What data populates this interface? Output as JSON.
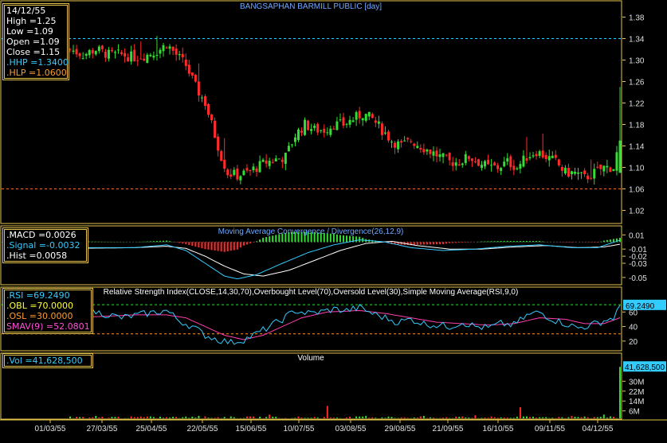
{
  "chart_data": {
    "type": "candlestick",
    "title": "BANGSAPHAN BARMILL PUBLIC [day]",
    "colors": {
      "background": "#000000",
      "frame": "#e6c34a",
      "up": "#33dd33",
      "down": "#ff2a2a",
      "text": "#e0e0e0",
      "title": "#6fa8ff",
      "hhp_line": "#33ccff",
      "hlp_line": "#ff6a2a"
    },
    "x_tick_labels": [
      "01/03/55",
      "27/03/55",
      "25/04/55",
      "22/05/55",
      "15/06/55",
      "10/07/55",
      "03/08/55",
      "29/08/55",
      "21/09/55",
      "16/10/55",
      "09/11/55",
      "04/12/55"
    ],
    "price_panel": {
      "ylim": [
        1.0,
        1.4
      ],
      "y_ticks": [
        "1.02",
        "1.06",
        "1.10",
        "1.14",
        "1.18",
        "1.22",
        "1.26",
        "1.30",
        "1.34",
        "1.38"
      ],
      "hhp": 1.34,
      "hlp": 1.06,
      "close_path": [
        [
          0,
          1.32
        ],
        [
          4,
          1.31
        ],
        [
          8,
          1.32
        ],
        [
          12,
          1.31
        ],
        [
          16,
          1.31
        ],
        [
          20,
          1.305
        ],
        [
          24,
          1.31
        ],
        [
          28,
          1.32
        ],
        [
          30,
          1.33
        ],
        [
          33,
          1.31
        ],
        [
          36,
          1.29
        ],
        [
          39,
          1.25
        ],
        [
          42,
          1.22
        ],
        [
          45,
          1.16
        ],
        [
          47,
          1.12
        ],
        [
          49,
          1.09
        ],
        [
          52,
          1.085
        ],
        [
          55,
          1.09
        ],
        [
          58,
          1.1
        ],
        [
          61,
          1.11
        ],
        [
          64,
          1.115
        ],
        [
          67,
          1.12
        ],
        [
          70,
          1.16
        ],
        [
          73,
          1.18
        ],
        [
          76,
          1.17
        ],
        [
          79,
          1.17
        ],
        [
          82,
          1.18
        ],
        [
          85,
          1.18
        ],
        [
          88,
          1.19
        ],
        [
          91,
          1.2
        ],
        [
          94,
          1.19
        ],
        [
          97,
          1.17
        ],
        [
          100,
          1.15
        ],
        [
          103,
          1.14
        ],
        [
          106,
          1.15
        ],
        [
          109,
          1.14
        ],
        [
          112,
          1.13
        ],
        [
          115,
          1.12
        ],
        [
          118,
          1.11
        ],
        [
          121,
          1.11
        ],
        [
          124,
          1.12
        ],
        [
          127,
          1.11
        ],
        [
          130,
          1.1
        ],
        [
          133,
          1.1
        ],
        [
          136,
          1.11
        ],
        [
          139,
          1.1
        ],
        [
          142,
          1.12
        ],
        [
          145,
          1.13
        ],
        [
          148,
          1.12
        ],
        [
          151,
          1.11
        ],
        [
          154,
          1.09
        ],
        [
          157,
          1.09
        ],
        [
          160,
          1.08
        ],
        [
          163,
          1.09
        ],
        [
          166,
          1.1
        ],
        [
          169,
          1.1
        ],
        [
          171,
          1.15
        ]
      ],
      "last": {
        "date": "14/12/55",
        "high": 1.25,
        "low": 1.09,
        "open": 1.09,
        "close": 1.15
      }
    },
    "macd_panel": {
      "title": "Moving Average Convergence / Divergence(26,12,9)",
      "ylim": [
        -0.058,
        0.016
      ],
      "y_ticks": [
        "0.01",
        "-0.01",
        "-0.02",
        "-0.03",
        "-0.05"
      ],
      "macd_path": [
        [
          0,
          -0.008
        ],
        [
          20,
          -0.008
        ],
        [
          30,
          -0.004
        ],
        [
          36,
          -0.012
        ],
        [
          42,
          -0.03
        ],
        [
          48,
          -0.048
        ],
        [
          52,
          -0.052
        ],
        [
          58,
          -0.046
        ],
        [
          66,
          -0.03
        ],
        [
          74,
          -0.015
        ],
        [
          82,
          -0.004
        ],
        [
          90,
          0.003
        ],
        [
          98,
          0.0
        ],
        [
          106,
          -0.008
        ],
        [
          116,
          -0.012
        ],
        [
          126,
          -0.01
        ],
        [
          136,
          -0.006
        ],
        [
          146,
          -0.004
        ],
        [
          156,
          -0.008
        ],
        [
          164,
          -0.008
        ],
        [
          171,
          0.0026
        ]
      ],
      "signal_path": [
        [
          0,
          -0.009
        ],
        [
          20,
          -0.008
        ],
        [
          30,
          -0.006
        ],
        [
          36,
          -0.009
        ],
        [
          42,
          -0.02
        ],
        [
          48,
          -0.034
        ],
        [
          54,
          -0.045
        ],
        [
          60,
          -0.048
        ],
        [
          68,
          -0.04
        ],
        [
          76,
          -0.026
        ],
        [
          84,
          -0.012
        ],
        [
          92,
          -0.002
        ],
        [
          100,
          0.001
        ],
        [
          108,
          -0.005
        ],
        [
          118,
          -0.01
        ],
        [
          128,
          -0.01
        ],
        [
          138,
          -0.007
        ],
        [
          148,
          -0.005
        ],
        [
          158,
          -0.008
        ],
        [
          166,
          -0.007
        ],
        [
          171,
          -0.0032
        ]
      ],
      "macd": 0.0026,
      "signal": -0.0032,
      "hist": 0.0058
    },
    "rsi_panel": {
      "title": "Relative Strength Index(CLOSE,14,30,70),Overbought Level(70),Oversold Level(30),Simple Moving Average(RSI,9,0)",
      "ylim": [
        10,
        80
      ],
      "y_ticks": [
        "20",
        "40",
        "60"
      ],
      "rsi_path": [
        [
          0,
          55
        ],
        [
          8,
          60
        ],
        [
          16,
          52
        ],
        [
          24,
          58
        ],
        [
          30,
          62
        ],
        [
          34,
          48
        ],
        [
          38,
          40
        ],
        [
          42,
          28
        ],
        [
          46,
          22
        ],
        [
          50,
          18
        ],
        [
          54,
          22
        ],
        [
          58,
          30
        ],
        [
          62,
          40
        ],
        [
          66,
          50
        ],
        [
          70,
          62
        ],
        [
          74,
          58
        ],
        [
          78,
          60
        ],
        [
          82,
          64
        ],
        [
          86,
          62
        ],
        [
          90,
          66
        ],
        [
          94,
          58
        ],
        [
          98,
          52
        ],
        [
          102,
          46
        ],
        [
          106,
          50
        ],
        [
          110,
          44
        ],
        [
          114,
          42
        ],
        [
          118,
          40
        ],
        [
          122,
          46
        ],
        [
          126,
          40
        ],
        [
          130,
          38
        ],
        [
          134,
          44
        ],
        [
          138,
          42
        ],
        [
          142,
          55
        ],
        [
          146,
          60
        ],
        [
          150,
          50
        ],
        [
          154,
          44
        ],
        [
          158,
          38
        ],
        [
          162,
          42
        ],
        [
          166,
          48
        ],
        [
          169,
          52
        ],
        [
          171,
          69.249
        ]
      ],
      "sma_path": [
        [
          0,
          52
        ],
        [
          10,
          54
        ],
        [
          20,
          56
        ],
        [
          30,
          56
        ],
        [
          36,
          52
        ],
        [
          42,
          40
        ],
        [
          48,
          28
        ],
        [
          54,
          22
        ],
        [
          60,
          28
        ],
        [
          66,
          40
        ],
        [
          72,
          52
        ],
        [
          80,
          60
        ],
        [
          90,
          62
        ],
        [
          98,
          58
        ],
        [
          106,
          52
        ],
        [
          114,
          46
        ],
        [
          122,
          44
        ],
        [
          130,
          42
        ],
        [
          138,
          44
        ],
        [
          146,
          52
        ],
        [
          154,
          50
        ],
        [
          160,
          44
        ],
        [
          166,
          44
        ],
        [
          171,
          52.0801
        ]
      ],
      "rsi": 69.249,
      "obl": 70.0,
      "osl": 30.0,
      "smav": 52.0801,
      "value_label": "69.2490",
      "colors": {
        "rsi": "#33ccff",
        "sma": "#ff3fb0",
        "obl": "#33dd33",
        "osl": "#ff9a2e"
      }
    },
    "volume_panel": {
      "title": "Volume",
      "ylim": [
        0,
        45
      ],
      "y_ticks": [
        "6M",
        "14M",
        "22M",
        "30M"
      ],
      "value_label": "41,628,500",
      "spikes": [
        [
          8,
          2
        ],
        [
          24,
          1.5
        ],
        [
          40,
          2
        ],
        [
          62,
          3
        ],
        [
          80,
          10
        ],
        [
          92,
          2
        ],
        [
          110,
          2
        ],
        [
          126,
          2.5
        ],
        [
          140,
          9
        ],
        [
          156,
          2
        ],
        [
          166,
          3
        ],
        [
          171,
          41.6285
        ]
      ],
      "volume": "41,628,500"
    }
  },
  "legend_price": {
    "date": "14/12/55",
    "high": "High =1.25",
    "low": "Low =1.09",
    "open": "Open =1.09",
    "close": "Close =1.15",
    "hhp": ".HHP =1.3400",
    "hlp": ".HLP =1.0600"
  },
  "legend_macd": {
    "macd": ".MACD =0.0026",
    "signal": ".Signal =-0.0032",
    "hist": ".Hist =0.0058"
  },
  "legend_rsi": {
    "rsi": ".RSI =69.2490",
    "obl": ".OBL =70.0000",
    "osl": ".OSL =30.0000",
    "smav": "SMAV(9) =52.0801"
  },
  "legend_volume": {
    "vol": ".Vol =41,628,500"
  }
}
